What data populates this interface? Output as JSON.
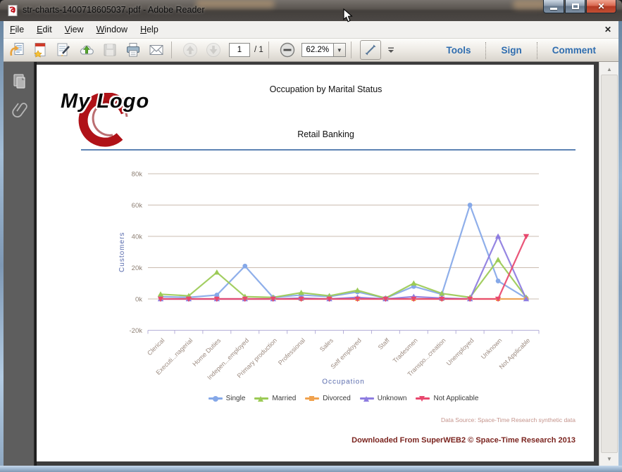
{
  "window": {
    "title": "str-charts-1400718605037.pdf - Adobe Reader"
  },
  "menu": {
    "items": [
      "File",
      "Edit",
      "View",
      "Window",
      "Help"
    ]
  },
  "toolbar": {
    "page_current": "1",
    "page_total": "/ 1",
    "zoom_level": "62.2%",
    "tools_label": "Tools",
    "sign_label": "Sign",
    "comment_label": "Comment"
  },
  "document": {
    "title": "Occupation by Marital Status",
    "subtitle": "Retail Banking",
    "logo_text": "My Logo",
    "data_source": "Data Source: Space-Time Research synthetic data",
    "footer": "Downloaded From SuperWEB2 © Space-Time Research 2013"
  },
  "chart_data": {
    "type": "line",
    "title": "Occupation by Marital Status",
    "xlabel": "Occupation",
    "ylabel": "Customers",
    "ylim": [
      -20000,
      80000
    ],
    "grid": true,
    "legend_position": "bottom",
    "yticks": [
      {
        "v": 80000,
        "label": "80k"
      },
      {
        "v": 60000,
        "label": "60k"
      },
      {
        "v": 40000,
        "label": "40k"
      },
      {
        "v": 20000,
        "label": "20k"
      },
      {
        "v": 0,
        "label": "0k"
      },
      {
        "v": -20000,
        "label": "-20k"
      }
    ],
    "categories": [
      "Clerical",
      "Executi...nagerial",
      "Home Duties",
      "Indepen...employed",
      "Primary production",
      "Professional",
      "Sales",
      "Self employed",
      "Staff",
      "Tradesmen",
      "Transpo...creation",
      "Unemployed",
      "Unknown",
      "Not Applicable"
    ],
    "series": [
      {
        "name": "Single",
        "color": "#85a8e8",
        "marker": "circle",
        "values": [
          1500,
          1000,
          2500,
          21000,
          1000,
          2500,
          1500,
          4500,
          500,
          8000,
          3000,
          60000,
          11500,
          500
        ]
      },
      {
        "name": "Married",
        "color": "#9bca55",
        "marker": "triangle",
        "values": [
          3000,
          2000,
          17000,
          1500,
          1000,
          4000,
          2000,
          5500,
          500,
          10000,
          3500,
          1000,
          25000,
          1000
        ]
      },
      {
        "name": "Divorced",
        "color": "#f0a24f",
        "marker": "square",
        "values": [
          0,
          0,
          0,
          0,
          0,
          0,
          0,
          0,
          0,
          0,
          0,
          0,
          0,
          0
        ]
      },
      {
        "name": "Unknown",
        "color": "#8d7ce0",
        "marker": "triangle",
        "values": [
          0,
          0,
          0,
          0,
          0,
          500,
          0,
          1000,
          0,
          1500,
          500,
          0,
          40000,
          0
        ]
      },
      {
        "name": "Not Applicable",
        "color": "#e8486e",
        "marker": "triangle-down",
        "values": [
          0,
          0,
          0,
          0,
          0,
          0,
          0,
          0,
          0,
          0,
          0,
          0,
          0,
          40000
        ]
      }
    ]
  }
}
